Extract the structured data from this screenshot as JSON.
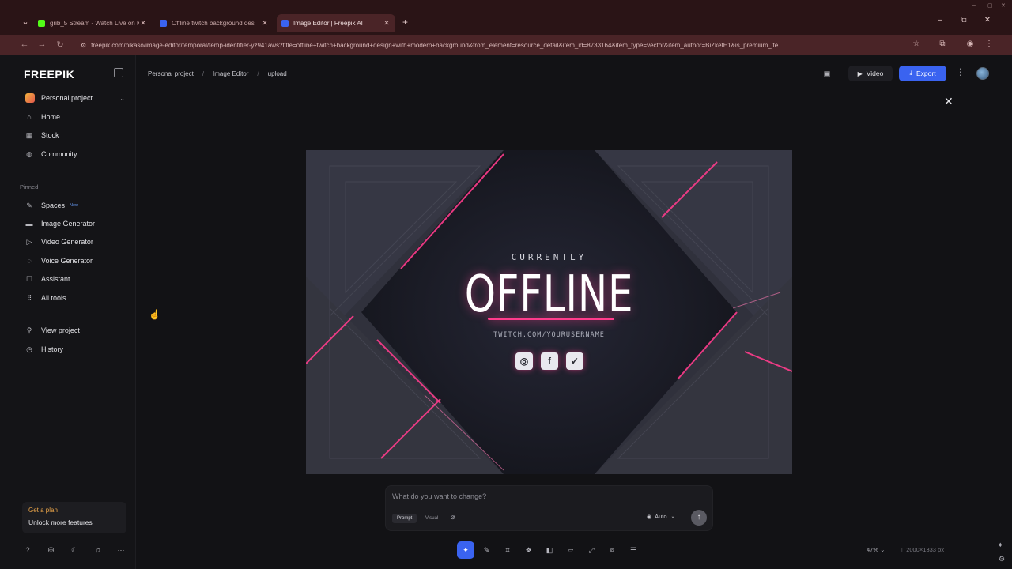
{
  "browser": {
    "tabs": [
      {
        "title": "grib_5 Stream - Watch Live on K",
        "icon_color": "#53fc18"
      },
      {
        "title": "Offline twitch background desi",
        "icon_color": "#3a63f0"
      },
      {
        "title": "Image Editor | Freepik AI",
        "icon_color": "#3a63f0",
        "active": true
      }
    ],
    "url": "freepik.com/pikaso/image-editor/temporal/temp-identifier-yz941aws?title=offline+twitch+background+design+with+modern+background&from_element=resource_detail&item_id=8733164&item_type=vector&item_author=BiZketE1&is_premium_ite..."
  },
  "sidebar": {
    "logo": "FREEPIK",
    "project": "Personal project",
    "main_items": [
      {
        "label": "Home",
        "icon": "home-icon"
      },
      {
        "label": "Stock",
        "icon": "grid-icon"
      },
      {
        "label": "Community",
        "icon": "globe-icon"
      }
    ],
    "pinned_label": "Pinned",
    "pinned_items": [
      {
        "label": "Spaces",
        "icon": "spaces-icon",
        "badge": "New"
      },
      {
        "label": "Image Generator",
        "icon": "image-icon"
      },
      {
        "label": "Video Generator",
        "icon": "video-icon"
      },
      {
        "label": "Voice Generator",
        "icon": "voice-icon"
      },
      {
        "label": "Assistant",
        "icon": "assistant-icon"
      },
      {
        "label": "All tools",
        "icon": "apps-icon"
      }
    ],
    "extra_items": [
      {
        "label": "View project",
        "icon": "project-icon"
      },
      {
        "label": "History",
        "icon": "history-icon"
      }
    ],
    "plan": {
      "title": "Get a plan",
      "subtitle": "Unlock more features"
    }
  },
  "header": {
    "breadcrumb": [
      "Personal project",
      "Image Editor",
      "upload"
    ],
    "video_label": "Video",
    "export_label": "Export",
    "accent_color": "#3a63f0"
  },
  "artwork": {
    "line1": "CURRENTLY",
    "headline": "OFFLINE",
    "handle": "TWITCH.COM/YOURUSERNAME",
    "socials": [
      "instagram-icon",
      "facebook-icon",
      "twitter-icon"
    ],
    "accent": "#ff3c8c"
  },
  "prompt": {
    "placeholder": "What do you want to change?",
    "modes": [
      "Prompt",
      "Visual"
    ],
    "model": "Auto"
  },
  "status": {
    "zoom": "47%",
    "dimensions": "2000×1333 px"
  }
}
